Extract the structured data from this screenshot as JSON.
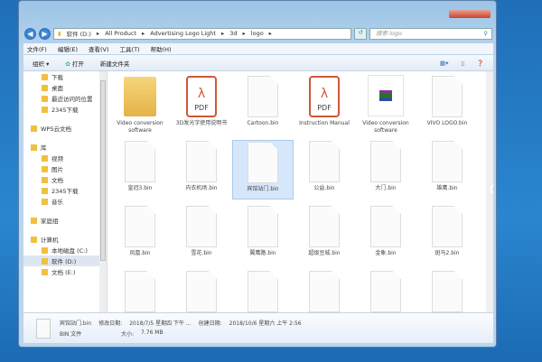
{
  "address": {
    "path": [
      "软件 (D:)",
      "All Product",
      "Advertising Logo Light",
      "3d",
      "logo"
    ],
    "search_placeholder": "搜索 logo"
  },
  "menu": [
    "文件(F)",
    "编辑(E)",
    "查看(V)",
    "工具(T)",
    "帮助(H)"
  ],
  "toolbar": {
    "organize": "组织 ▾",
    "open": "打开",
    "new_folder": "新建文件夹"
  },
  "sidebar": [
    {
      "label": "下载",
      "type": "item"
    },
    {
      "label": "桌面",
      "type": "item"
    },
    {
      "label": "最近访问的位置",
      "type": "item"
    },
    {
      "label": "2345下载",
      "type": "item"
    },
    {
      "label": "WPS云文档",
      "type": "head"
    },
    {
      "label": "库",
      "type": "head"
    },
    {
      "label": "视频",
      "type": "item"
    },
    {
      "label": "图片",
      "type": "item"
    },
    {
      "label": "文档",
      "type": "item"
    },
    {
      "label": "2345下载",
      "type": "item"
    },
    {
      "label": "音乐",
      "type": "item"
    },
    {
      "label": "家庭组",
      "type": "head"
    },
    {
      "label": "计算机",
      "type": "head"
    },
    {
      "label": "本地磁盘 (C:)",
      "type": "item"
    },
    {
      "label": "软件 (D:)",
      "type": "item",
      "selected": true
    },
    {
      "label": "文档 (E:)",
      "type": "item"
    }
  ],
  "files": [
    {
      "name": "Video conversion software",
      "kind": "folder"
    },
    {
      "name": "3D发光字使用说明书",
      "kind": "pdf"
    },
    {
      "name": "Cartoon.bin",
      "kind": "blank"
    },
    {
      "name": "Instruction Manual",
      "kind": "pdf"
    },
    {
      "name": "Video conversion software",
      "kind": "rar"
    },
    {
      "name": "VIVO LOGO.bin",
      "kind": "blank"
    },
    {
      "name": "皇冠3.bin",
      "kind": "blank"
    },
    {
      "name": "内衣机场.bin",
      "kind": "blank"
    },
    {
      "name": "宾馆站门.bin",
      "kind": "blank",
      "selected": true
    },
    {
      "name": "公益.bin",
      "kind": "blank"
    },
    {
      "name": "大门.bin",
      "kind": "blank"
    },
    {
      "name": "雄鹰.bin",
      "kind": "blank"
    },
    {
      "name": "凤凰.bin",
      "kind": "blank"
    },
    {
      "name": "雪花.bin",
      "kind": "blank"
    },
    {
      "name": "翼鹰路.bin",
      "kind": "blank"
    },
    {
      "name": "超级豆城.bin",
      "kind": "blank"
    },
    {
      "name": "金象.bin",
      "kind": "blank"
    },
    {
      "name": "斑马2.bin",
      "kind": "blank"
    },
    {
      "name": "",
      "kind": "blank"
    },
    {
      "name": "",
      "kind": "blank"
    },
    {
      "name": "",
      "kind": "blank"
    },
    {
      "name": "",
      "kind": "blank"
    },
    {
      "name": "",
      "kind": "blank"
    },
    {
      "name": "",
      "kind": "blank"
    }
  ],
  "status": {
    "name": "宾馆站门.bin",
    "modified_label": "修改日期:",
    "modified": "2018/7/5 星期四 下午 ...",
    "created_label": "创建日期:",
    "created": "2018/10/6 星期六 上午 2:56",
    "type": "BIN 文件",
    "size_label": "大小:",
    "size": "7.76 MB"
  }
}
